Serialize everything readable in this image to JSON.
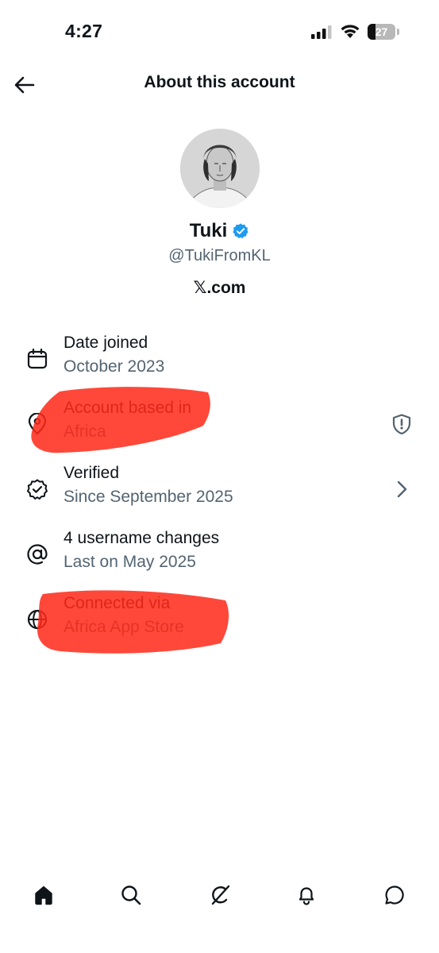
{
  "status_bar": {
    "time": "4:27",
    "battery_level": "27"
  },
  "header": {
    "title": "About this account",
    "back_icon": "arrow-left-icon"
  },
  "profile": {
    "name": "Tuki",
    "handle": "@TukiFromKL",
    "site": "𝕏.com",
    "verified_badge_color": "#1d9bf0"
  },
  "info_items": [
    {
      "icon": "calendar-icon",
      "label": "Date joined",
      "value": "October 2023"
    },
    {
      "icon": "location-pin-icon",
      "label": "Account based in",
      "value": "Africa",
      "trailing_icon": "shield-alert-icon"
    },
    {
      "icon": "verified-check-icon",
      "label": "Verified",
      "value": "Since September 2025",
      "trailing_icon": "chevron-right-icon"
    },
    {
      "icon": "at-sign-icon",
      "label": "4 username changes",
      "value": "Last on May 2025"
    },
    {
      "icon": "globe-icon",
      "label": "Connected via",
      "value": "Africa App Store"
    }
  ],
  "annotation": {
    "highlight_color": "#ff2a1a"
  },
  "bottom_nav": [
    "home-icon",
    "search-icon",
    "grok-icon",
    "notifications-icon",
    "messages-icon"
  ],
  "colors": {
    "text_primary": "#0f1419",
    "text_secondary": "#536471",
    "background": "#ffffff"
  }
}
